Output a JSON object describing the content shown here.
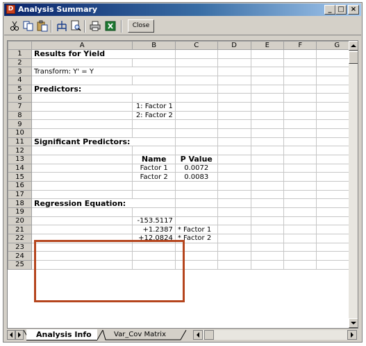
{
  "window": {
    "app_icon_letter": "D",
    "title": "Analysis Summary",
    "minimize_label": "_",
    "maximize_label": "□",
    "close_label": "×"
  },
  "toolbar": {
    "icons": [
      "cut-icon",
      "copy-icon",
      "paste-icon",
      "insert-icon",
      "preview-icon",
      "print-icon",
      "excel-icon"
    ],
    "close_label": "Close"
  },
  "sheet": {
    "columns": [
      "A",
      "B",
      "C",
      "D",
      "E",
      "F",
      "G"
    ],
    "rows": [
      {
        "n": "1",
        "A": "Results for Yield",
        "B": "",
        "C": ""
      },
      {
        "n": "2",
        "A": "",
        "B": "",
        "C": ""
      },
      {
        "n": "3",
        "A": "Transform: Y' = Y",
        "B": "",
        "C": ""
      },
      {
        "n": "4",
        "A": "",
        "B": "",
        "C": ""
      },
      {
        "n": "5",
        "A": "Predictors:",
        "B": "",
        "C": ""
      },
      {
        "n": "6",
        "A": "",
        "B": "",
        "C": ""
      },
      {
        "n": "7",
        "A": "",
        "B": "1: Factor 1",
        "C": ""
      },
      {
        "n": "8",
        "A": "",
        "B": "2: Factor 2",
        "C": ""
      },
      {
        "n": "9",
        "A": "",
        "B": "",
        "C": ""
      },
      {
        "n": "10",
        "A": "",
        "B": "",
        "C": ""
      },
      {
        "n": "11",
        "A": "Significant Predictors:",
        "B": "",
        "C": ""
      },
      {
        "n": "12",
        "A": "",
        "B": "",
        "C": ""
      },
      {
        "n": "13",
        "A": "",
        "B": "Name",
        "C": "P Value"
      },
      {
        "n": "14",
        "A": "",
        "B": "Factor 1",
        "C": "0.0072"
      },
      {
        "n": "15",
        "A": "",
        "B": "Factor 2",
        "C": "0.0083"
      },
      {
        "n": "16",
        "A": "",
        "B": "",
        "C": ""
      },
      {
        "n": "17",
        "A": "",
        "B": "",
        "C": ""
      },
      {
        "n": "18",
        "A": "Regression Equation:",
        "B": "",
        "C": ""
      },
      {
        "n": "19",
        "A": "",
        "B": "",
        "C": ""
      },
      {
        "n": "20",
        "A": "",
        "B": "-153.5117",
        "C": ""
      },
      {
        "n": "21",
        "A": "",
        "B": "+1.2387",
        "C": "* Factor 1"
      },
      {
        "n": "22",
        "A": "",
        "B": "+12.0824",
        "C": "* Factor 2"
      },
      {
        "n": "23",
        "A": "",
        "B": "",
        "C": ""
      },
      {
        "n": "24",
        "A": "",
        "B": "",
        "C": ""
      },
      {
        "n": "25",
        "A": "",
        "B": "",
        "C": ""
      }
    ]
  },
  "tabs": [
    {
      "label": "Analysis Info",
      "active": true
    },
    {
      "label": "Var_Cov Matrix",
      "active": false
    }
  ],
  "colors": {
    "highlight_box": "#b5451d",
    "title_bar": "#0a246a"
  }
}
